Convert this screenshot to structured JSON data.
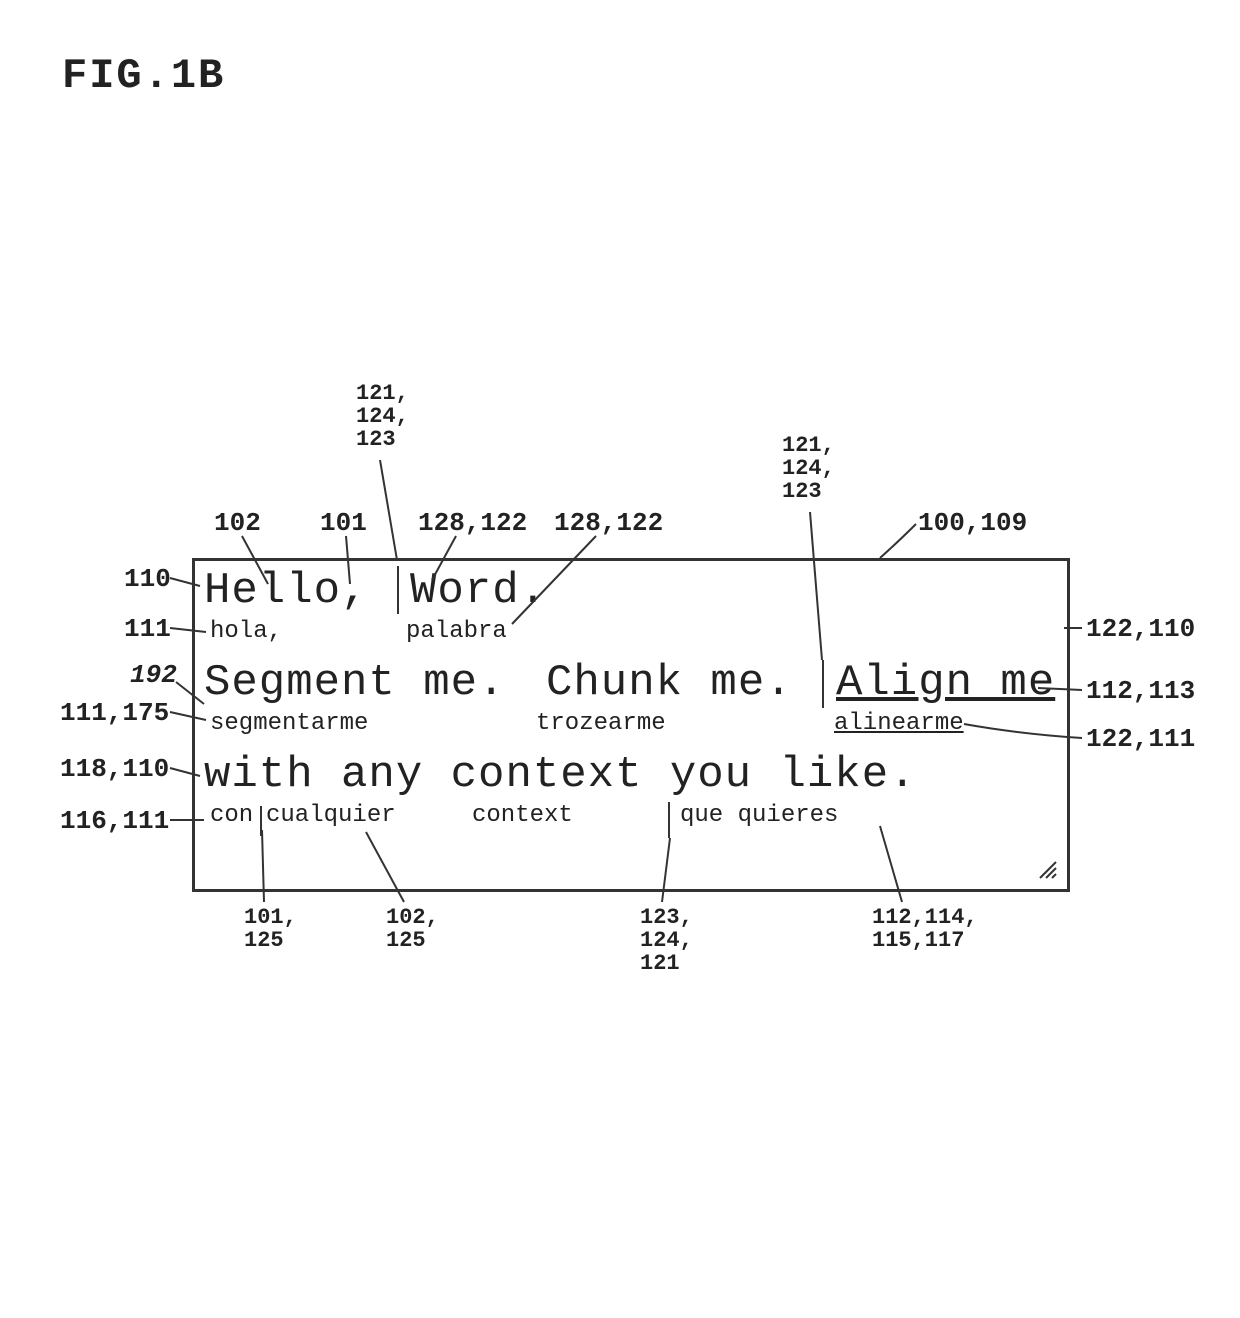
{
  "figure": {
    "label": "FIG.1B"
  },
  "refs": {
    "top_block_left": "121,\n124,\n123",
    "top_block_right": "121,\n124,\n123",
    "r102": "102",
    "r101": "101",
    "r128_122a": "128,122",
    "r128_122b": "128,122",
    "r100_109": "100,109",
    "r110": "110",
    "r111": "111",
    "r192": "192",
    "r111_175": "111,175",
    "r118_110": "118,110",
    "r116_111": "116,111",
    "r101_125": "101,\n125",
    "r102_125": "102,\n125",
    "r123_124_121": "123,\n124,\n121",
    "r112_114_115_117": "112,114,\n115,117",
    "r122_110": "122,110",
    "r112_113": "112,113",
    "r122_111": "122,111"
  },
  "english": {
    "line1": "Hello, Word.",
    "line1a": "Hello,",
    "line1b": "Word.",
    "line2a": "Segment me.",
    "line2b": "Chunk me.",
    "line2c": "Align me",
    "line3": "with any context you like."
  },
  "spanish": {
    "l1a": "hola,",
    "l1b": "palabra",
    "l2a": "segmentarme",
    "l2b": "trozearme",
    "l2c": "alinearme",
    "l3a": "con",
    "l3b": "cualquier",
    "l3c": "context",
    "l3d": "que quieres"
  }
}
